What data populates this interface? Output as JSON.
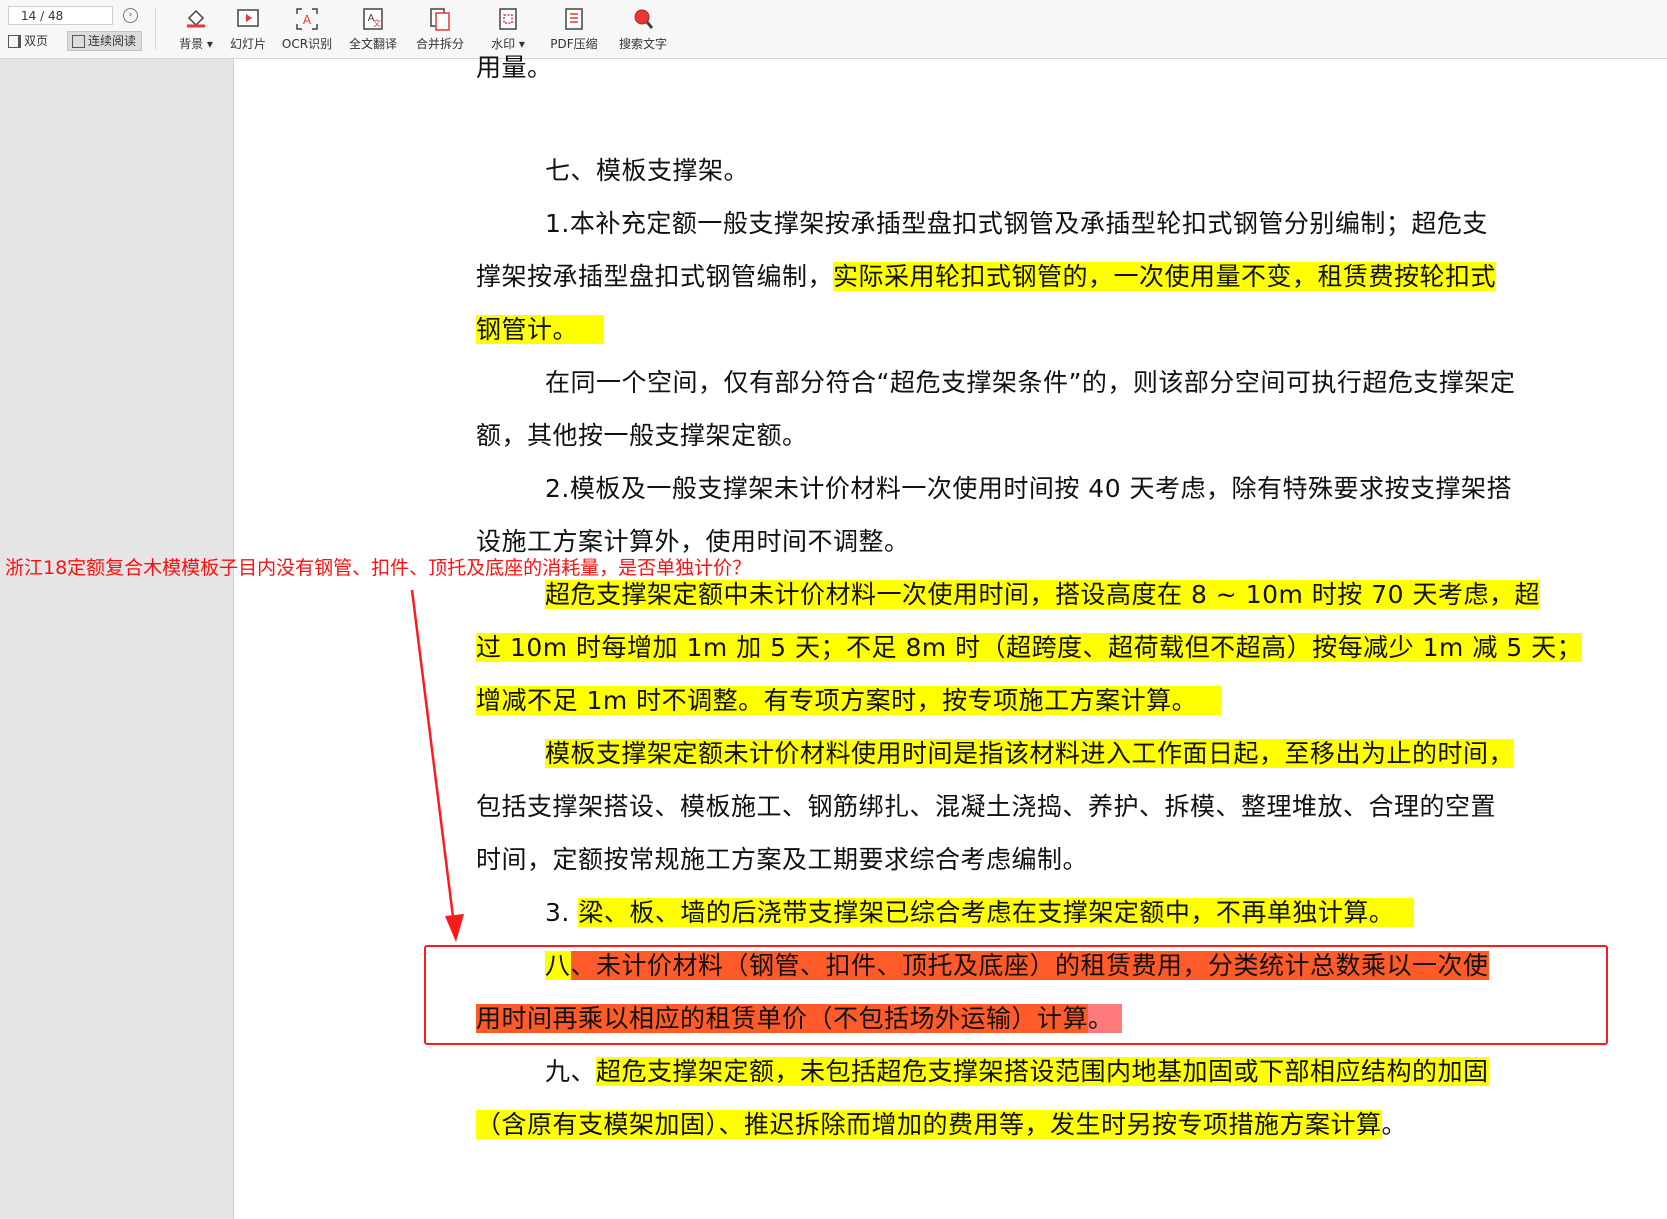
{
  "toolbar": {
    "page_indicator": "14 / 48",
    "view_double": "双页",
    "view_continuous": "连续阅读",
    "tools": {
      "background": "背景",
      "slideshow": "幻灯片",
      "ocr": "OCR识别",
      "translate": "全文翻译",
      "merge_split": "合并拆分",
      "watermark": "水印",
      "pdf_compress": "PDF压缩",
      "search_text": "搜索文字"
    }
  },
  "annotation": {
    "question": "浙江18定额复合木模模板子目内没有钢管、扣件、顶托及底座的消耗量，是否单独计价？",
    "arrow_color": "#ff1a1a",
    "box_color": "#ff1a1a"
  },
  "colors": {
    "highlight_yellow": "#ffff00",
    "highlight_red": "#ff5a2a"
  },
  "document": {
    "l0": "用量。",
    "l1": "七、模板支撑架。",
    "l2": "1.本补充定额一般支撑架按承插型盘扣式钢管及承插型轮扣式钢管分别编制；超危支",
    "l3a": "撑架按承插型盘扣式钢管编制，",
    "l3b": "实际采用轮扣式钢管的，一次使用量不变，租赁费按轮扣式",
    "l4": "钢管计。",
    "l5": "在同一个空间，仅有部分符合“超危支撑架条件”的，则该部分空间可执行超危支撑架定",
    "l6": "额，其他按一般支撑架定额。",
    "l7": "2.模板及一般支撑架未计价材料一次使用时间按 40 天考虑，除有特殊要求按支撑架搭",
    "l8": "设施工方案计算外，使用时间不调整。",
    "l9": "超危支撑架定额中未计价材料一次使用时间，搭设高度在 8 ~ 10m 时按 70 天考虑，超",
    "l10": "过 10m 时每增加 1m 加 5 天；不足 8m 时（超跨度、超荷载但不超高）按每减少 1m 减 5 天；",
    "l11": "增减不足 1m 时不调整。有专项方案时，按专项施工方案计算。",
    "l12": "模板支撑架定额未计价材料使用时间是指该材料进入工作面日起，至移出为止的时间，",
    "l13": "包括支撑架搭设、模板施工、钢筋绑扎、混凝土浇捣、养护、拆模、整理堆放、合理的空置",
    "l14": "时间，定额按常规施工方案及工期要求综合考虑编制。",
    "l15a": "3. ",
    "l15b": "梁、板、墙的后浇带支撑架已综合考虑在支撑架定额中，不再单独计算。",
    "l16a": "八",
    "l16b": "、未计价材料（钢管、扣件、顶托及底座）的租赁费用，分类统计总数乘以一次使",
    "l17a": "用时间再乘以相应的租赁单价（不包括场外运输）计算",
    "l17b": "。",
    "l18a": "九、",
    "l18b": "超危支撑架定额，未包括超危支撑架搭设范围内地基加固或下部相应结构的加固",
    "l19a": "（含原有支模架加固）、推迟拆除而增加的费用等，发生时另按专项措施方案计算",
    "l19b": "。"
  }
}
